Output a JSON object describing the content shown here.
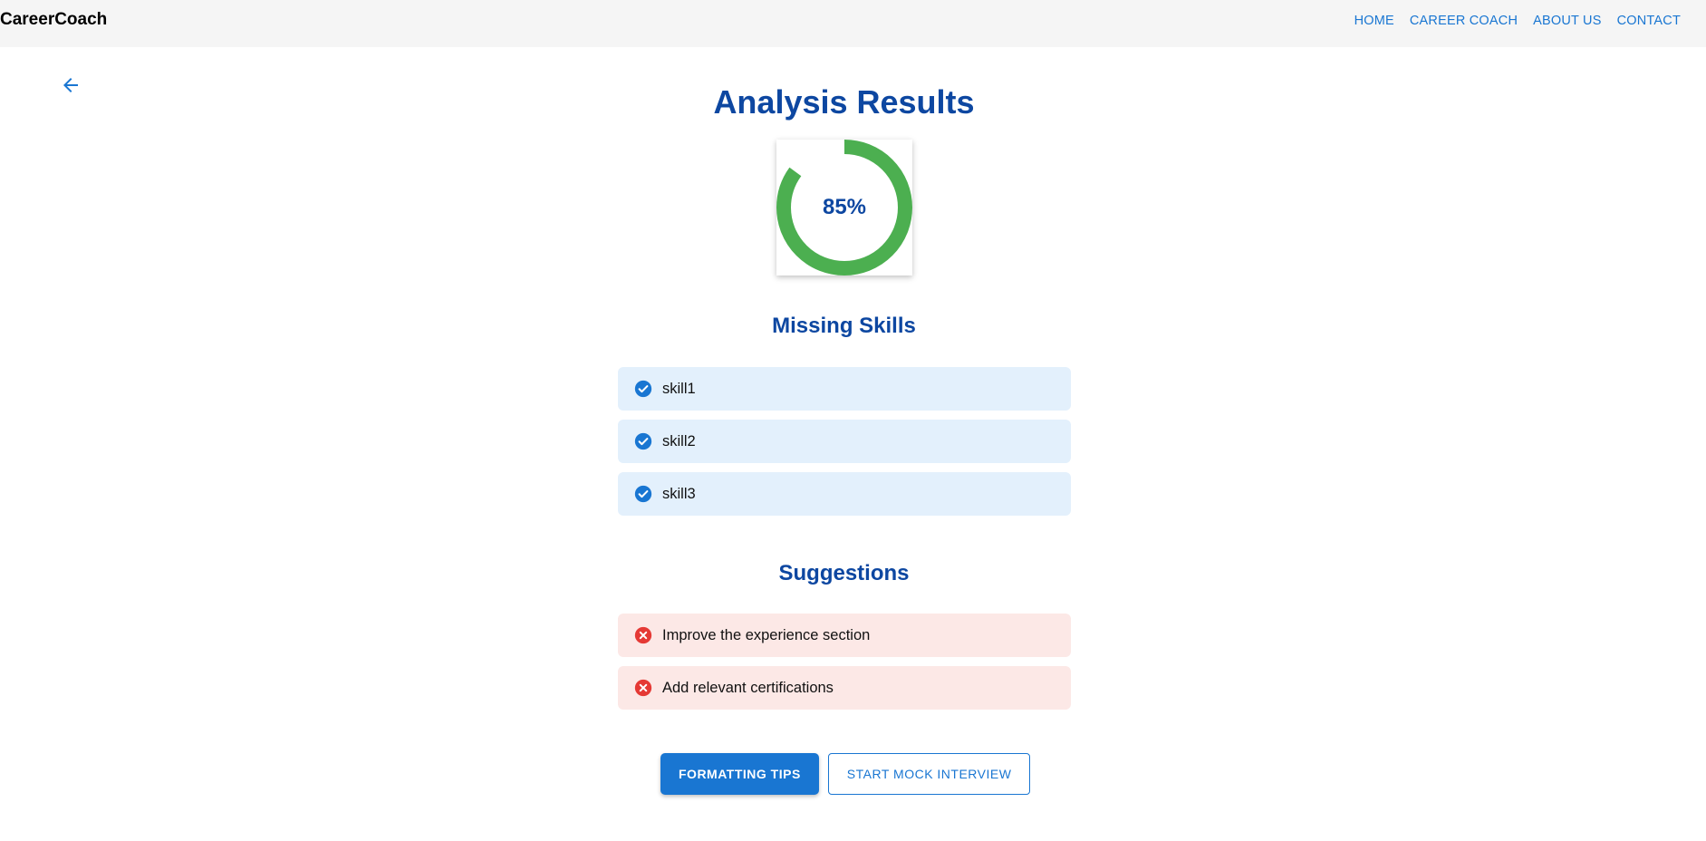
{
  "brand": "CareerCoach",
  "nav": {
    "home": "HOME",
    "career_coach": "CAREER COACH",
    "about_us": "ABOUT US",
    "contact": "CONTACT"
  },
  "page_title": "Analysis Results",
  "score": {
    "label": "85%",
    "value": 0.85,
    "color": "#4caf50"
  },
  "missing_skills": {
    "title": "Missing Skills",
    "items": [
      "skill1",
      "skill2",
      "skill3"
    ]
  },
  "suggestions": {
    "title": "Suggestions",
    "items": [
      "Improve the experience section",
      "Add relevant certifications"
    ]
  },
  "actions": {
    "formatting_tips": "FORMATTING TIPS",
    "start_mock_interview": "START MOCK INTERVIEW"
  },
  "colors": {
    "accent": "#1976d2",
    "heading": "#0d47a1",
    "success": "#4caf50",
    "error": "#e53935"
  },
  "icons": {
    "back": "arrow-left-icon",
    "skill": "check-circle-icon",
    "suggestion": "close-circle-icon"
  }
}
